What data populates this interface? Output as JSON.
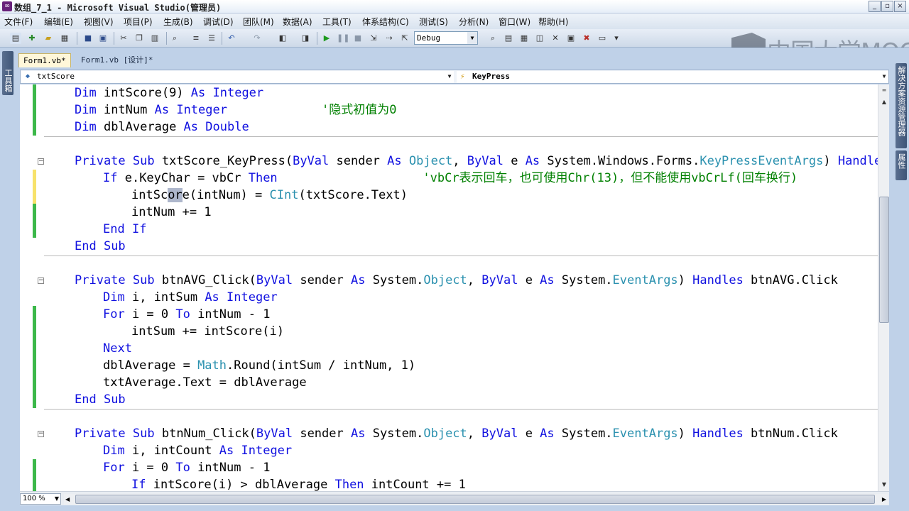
{
  "window": {
    "title": "数组_7_1 - Microsoft Visual Studio(管理员)",
    "app_icon": "visual-studio-icon",
    "buttons": [
      "_",
      "▫",
      "×"
    ]
  },
  "menu": [
    "文件(F)",
    "编辑(E)",
    "视图(V)",
    "项目(P)",
    "生成(B)",
    "调试(D)",
    "团队(M)",
    "数据(A)",
    "工具(T)",
    "体系结构(C)",
    "测试(S)",
    "分析(N)",
    "窗口(W)",
    "帮助(H)"
  ],
  "toolbar": {
    "config": "Debug"
  },
  "watermark": "中国大学MOOC",
  "side_panels": {
    "toolbox": "工具箱",
    "solution_explorer": "解决方案资源管理器",
    "properties": "属性"
  },
  "tabs": {
    "active": "Form1.vb*",
    "design": "Form1.vb [设计]*"
  },
  "nav": {
    "object": "txtScore",
    "event": "KeyPress"
  },
  "code": [
    {
      "indent": 1,
      "tokens": [
        [
          "kw",
          "Dim"
        ],
        [
          "",
          "intScore(9) "
        ],
        [
          "kw",
          "As"
        ],
        [
          "",
          ""
        ],
        [
          "kw",
          "Integer"
        ]
      ]
    },
    {
      "indent": 1,
      "tokens": [
        [
          "kw",
          "Dim"
        ],
        [
          "",
          "intNum "
        ],
        [
          "kw",
          "As"
        ],
        [
          "",
          ""
        ],
        [
          "kw",
          "Integer"
        ],
        [
          "",
          "             "
        ],
        [
          "cm",
          "'隐式初值为0"
        ]
      ]
    },
    {
      "indent": 1,
      "tokens": [
        [
          "kw",
          "Dim"
        ],
        [
          "",
          "dblAverage "
        ],
        [
          "kw",
          "As"
        ],
        [
          "",
          ""
        ],
        [
          "kw",
          "Double"
        ]
      ]
    },
    {
      "indent": 0,
      "tokens": []
    },
    {
      "indent": 1,
      "tokens": [
        [
          "kw",
          "Private"
        ],
        [
          "",
          ""
        ],
        [
          "kw",
          "Sub"
        ],
        [
          "",
          "txtScore_KeyPress("
        ],
        [
          "kw",
          "ByVal"
        ],
        [
          "",
          "sender "
        ],
        [
          "kw",
          "As"
        ],
        [
          "",
          ""
        ],
        [
          "ty",
          "Object"
        ],
        [
          "",
          ", "
        ],
        [
          "kw",
          "ByVal"
        ],
        [
          "",
          "e "
        ],
        [
          "kw",
          "As"
        ],
        [
          "",
          "System.Windows.Forms."
        ],
        [
          "ty",
          "KeyPressEventArgs"
        ],
        [
          "",
          ") "
        ],
        [
          "kw",
          "Handles"
        ]
      ]
    },
    {
      "indent": 2,
      "tokens": [
        [
          "kw",
          "If"
        ],
        [
          "",
          "e.KeyChar = vbCr "
        ],
        [
          "kw",
          "Then"
        ],
        [
          "",
          "                    "
        ],
        [
          "cm",
          "'vbCr表示回车，也可使用Chr(13)，但不能使用vbCrLf(回车换行)"
        ]
      ]
    },
    {
      "indent": 3,
      "tokens": [
        [
          "",
          "intSc"
        ],
        [
          "hl",
          "or"
        ],
        [
          "",
          "e(intNum) = "
        ],
        [
          "ty",
          "CInt"
        ],
        [
          "",
          "(txtScore.Text)"
        ]
      ]
    },
    {
      "indent": 3,
      "tokens": [
        [
          "",
          "intNum += 1"
        ]
      ]
    },
    {
      "indent": 2,
      "tokens": [
        [
          "kw",
          "End"
        ],
        [
          "",
          ""
        ],
        [
          "kw",
          "If"
        ]
      ]
    },
    {
      "indent": 1,
      "tokens": [
        [
          "kw",
          "End"
        ],
        [
          "",
          ""
        ],
        [
          "kw",
          "Sub"
        ]
      ]
    },
    {
      "indent": 0,
      "tokens": []
    },
    {
      "indent": 1,
      "tokens": [
        [
          "kw",
          "Private"
        ],
        [
          "",
          ""
        ],
        [
          "kw",
          "Sub"
        ],
        [
          "",
          "btnAVG_Click("
        ],
        [
          "kw",
          "ByVal"
        ],
        [
          "",
          "sender "
        ],
        [
          "kw",
          "As"
        ],
        [
          "",
          "System."
        ],
        [
          "ty",
          "Object"
        ],
        [
          "",
          ", "
        ],
        [
          "kw",
          "ByVal"
        ],
        [
          "",
          "e "
        ],
        [
          "kw",
          "As"
        ],
        [
          "",
          "System."
        ],
        [
          "ty",
          "EventArgs"
        ],
        [
          "",
          ") "
        ],
        [
          "kw",
          "Handles"
        ],
        [
          "",
          "btnAVG.Click"
        ]
      ]
    },
    {
      "indent": 2,
      "tokens": [
        [
          "kw",
          "Dim"
        ],
        [
          "",
          "i, intSum "
        ],
        [
          "kw",
          "As"
        ],
        [
          "",
          ""
        ],
        [
          "kw",
          "Integer"
        ]
      ]
    },
    {
      "indent": 2,
      "tokens": [
        [
          "kw",
          "For"
        ],
        [
          "",
          "i = 0 "
        ],
        [
          "kw",
          "To"
        ],
        [
          "",
          "intNum - 1"
        ]
      ]
    },
    {
      "indent": 3,
      "tokens": [
        [
          "",
          "intSum += intScore(i)"
        ]
      ]
    },
    {
      "indent": 2,
      "tokens": [
        [
          "kw",
          "Next"
        ]
      ]
    },
    {
      "indent": 2,
      "tokens": [
        [
          "",
          "dblAverage = "
        ],
        [
          "ty",
          "Math"
        ],
        [
          "",
          ".Round(intSum / intNum, 1)"
        ]
      ]
    },
    {
      "indent": 2,
      "tokens": [
        [
          "",
          "txtAverage.Text = dblAverage"
        ]
      ]
    },
    {
      "indent": 1,
      "tokens": [
        [
          "kw",
          "End"
        ],
        [
          "",
          ""
        ],
        [
          "kw",
          "Sub"
        ]
      ]
    },
    {
      "indent": 0,
      "tokens": []
    },
    {
      "indent": 1,
      "tokens": [
        [
          "kw",
          "Private"
        ],
        [
          "",
          ""
        ],
        [
          "kw",
          "Sub"
        ],
        [
          "",
          "btnNum_Click("
        ],
        [
          "kw",
          "ByVal"
        ],
        [
          "",
          "sender "
        ],
        [
          "kw",
          "As"
        ],
        [
          "",
          "System."
        ],
        [
          "ty",
          "Object"
        ],
        [
          "",
          ", "
        ],
        [
          "kw",
          "ByVal"
        ],
        [
          "",
          "e "
        ],
        [
          "kw",
          "As"
        ],
        [
          "",
          "System."
        ],
        [
          "ty",
          "EventArgs"
        ],
        [
          "",
          ") "
        ],
        [
          "kw",
          "Handles"
        ],
        [
          "",
          "btnNum.Click"
        ]
      ]
    },
    {
      "indent": 2,
      "tokens": [
        [
          "kw",
          "Dim"
        ],
        [
          "",
          "i, intCount "
        ],
        [
          "kw",
          "As"
        ],
        [
          "",
          ""
        ],
        [
          "kw",
          "Integer"
        ]
      ]
    },
    {
      "indent": 2,
      "tokens": [
        [
          "kw",
          "For"
        ],
        [
          "",
          "i = 0 "
        ],
        [
          "kw",
          "To"
        ],
        [
          "",
          "intNum - 1"
        ]
      ]
    },
    {
      "indent": 3,
      "tokens": [
        [
          "kw",
          "If"
        ],
        [
          "",
          "intScore(i) > dblAverage "
        ],
        [
          "kw",
          "Then"
        ],
        [
          "",
          "intCount += 1"
        ]
      ]
    }
  ],
  "zoom": "100 %",
  "colors": {
    "keyword": "#1010e0",
    "type": "#2b91af",
    "comment": "#008000",
    "saved_change_bar": "#3cb84a",
    "unsaved_change_bar": "#f7e26b"
  }
}
